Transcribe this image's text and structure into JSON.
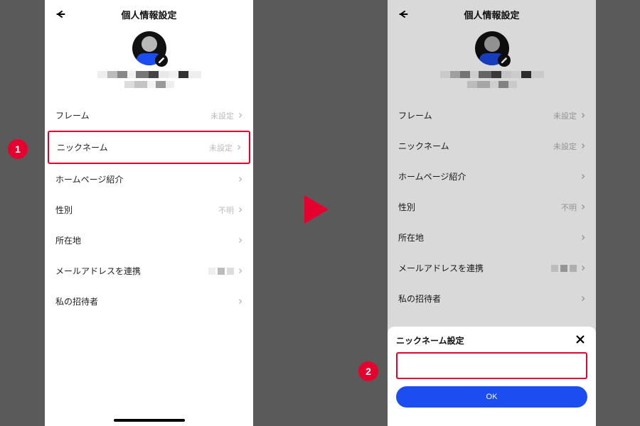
{
  "header": {
    "title": "個人情報設定"
  },
  "items": {
    "frame": {
      "label": "フレーム",
      "value": "未設定"
    },
    "nickname": {
      "label": "ニックネーム",
      "value": "未設定"
    },
    "homepage": {
      "label": "ホームページ紹介",
      "value": ""
    },
    "gender": {
      "label": "性別",
      "value": "不明"
    },
    "location": {
      "label": "所在地",
      "value": ""
    },
    "email": {
      "label": "メールアドレスを連携",
      "value": ""
    },
    "inviter": {
      "label": "私の招待者",
      "value": ""
    }
  },
  "modal": {
    "title": "ニックネーム設定",
    "ok": "OK",
    "value": ""
  },
  "badges": {
    "one": "1",
    "two": "2"
  }
}
